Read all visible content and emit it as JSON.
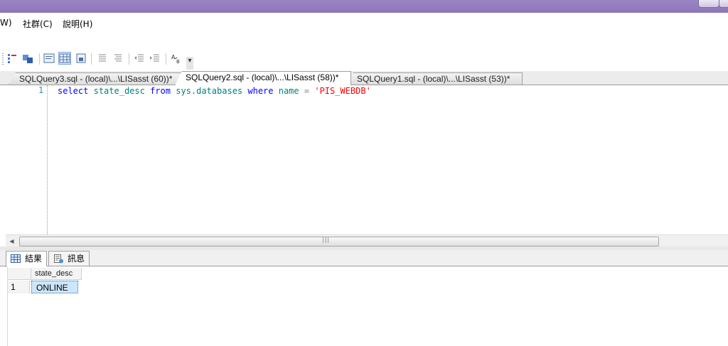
{
  "menu": {
    "items": [
      {
        "label": "W)"
      },
      {
        "label": "社群(C)"
      },
      {
        "label": "說明(H)"
      }
    ]
  },
  "toolbar": {
    "icons": [
      "results-to-text-icon",
      "results-to-grid-icon",
      "results-to-file-icon",
      "comment-icon",
      "uncomment-icon",
      "decrease-indent-icon",
      "increase-indent-icon",
      "specify-values-icon"
    ],
    "overflow_label": "▾"
  },
  "tabs": [
    {
      "label": "SQLQuery3.sql - (local)\\...\\LISasst (60))*"
    },
    {
      "label": "SQLQuery2.sql - (local)\\...\\LISasst (58))*"
    },
    {
      "label": "SQLQuery1.sql - (local)\\...\\LISasst (53))*"
    }
  ],
  "editor": {
    "line_number": "1",
    "tokens": {
      "select": "select",
      "col": "state_desc",
      "from": "from",
      "table": "sys.databases",
      "where": "where",
      "name": "name",
      "eq": "=",
      "value": "'PIS_WEBDB'"
    }
  },
  "results_tabs": [
    {
      "label": "結果"
    },
    {
      "label": "訊息"
    }
  ],
  "grid": {
    "columns": [
      "state_desc"
    ],
    "rows": [
      {
        "row_number": "1",
        "state_desc": "ONLINE"
      }
    ]
  },
  "colors": {
    "keyword": "#0000ff",
    "identifier": "#008080",
    "string": "#ff0000",
    "line_number": "#2b91af",
    "title_bar": "#9b86c4"
  }
}
